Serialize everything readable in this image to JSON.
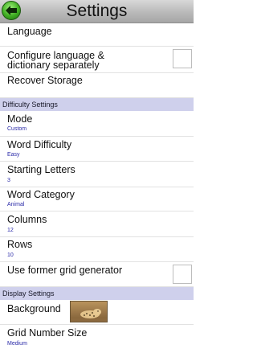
{
  "header": {
    "title": "Settings"
  },
  "rows": {
    "language": "Language",
    "configure_line1": "Configure language &",
    "configure_line2": "dictionary separately",
    "recover": "Recover Storage",
    "mode_title": "Mode",
    "mode_value": "Custom",
    "word_difficulty_title": "Word Difficulty",
    "word_difficulty_value": "Easy",
    "starting_letters_title": "Starting Letters",
    "starting_letters_value": "3",
    "word_category_title": "Word Category",
    "word_category_value": "Animal",
    "columns_title": "Columns",
    "columns_value": "12",
    "rows_title": "Rows",
    "rows_value": "10",
    "former_grid_title": "Use former grid generator",
    "background_title": "Background",
    "grid_number_size_title": "Grid Number Size",
    "grid_number_size_value": "Medium"
  },
  "sections": {
    "difficulty": "Difficulty Settings",
    "display": "Display Settings"
  },
  "colors": {
    "section_bg": "#cfd0ec",
    "value_text": "#2a2aa8",
    "back_button": "#3fae22"
  },
  "icons": {
    "back": "back-arrow-icon",
    "background_preview": "cheetah-image"
  }
}
